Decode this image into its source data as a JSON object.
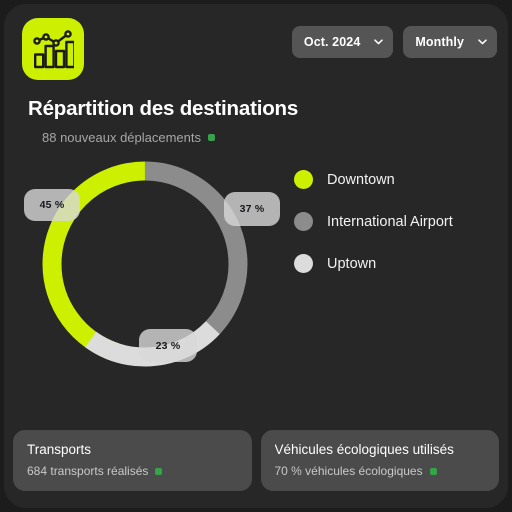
{
  "header": {
    "logo_icon": "bar-line-chart-icon",
    "logo_bg": "#ccf000",
    "filters": [
      {
        "label": "Oct. 2024",
        "icon": "chevron-down-icon"
      },
      {
        "label": "Monthly",
        "icon": "chevron-down-icon"
      }
    ]
  },
  "title": "Répartition des destinations",
  "subtitle": "88 nouveaux déplacements",
  "subtitle_badge_color": "#35a34a",
  "chart_data": {
    "type": "pie",
    "title": "Répartition des destinations",
    "subtitle": "88 nouveaux déplacements",
    "variant": "donut",
    "categories": [
      "Downtown",
      "International Airport",
      "Uptown"
    ],
    "values": [
      45,
      37,
      23
    ],
    "value_labels": [
      "45 %",
      "37 %",
      "23 %"
    ],
    "colors": [
      "#ccf000",
      "#8c8c8c",
      "#dcdcdc"
    ],
    "unit": "%",
    "start_angle_deg": 0,
    "direction": "counter-clockwise",
    "legend_position": "right",
    "grid": false
  },
  "legend": {
    "items": [
      {
        "label": "Downtown",
        "color": "#ccf000"
      },
      {
        "label": "International Airport",
        "color": "#8c8c8c"
      },
      {
        "label": "Uptown",
        "color": "#dcdcdc"
      }
    ]
  },
  "stat_cards": [
    {
      "title": "Transports",
      "subtitle": "684 transports réalisés",
      "badge_color": "#35a34a"
    },
    {
      "title": "Véhicules écologiques utilisés",
      "subtitle": "70 % véhicules écologiques",
      "badge_color": "#35a34a"
    }
  ]
}
